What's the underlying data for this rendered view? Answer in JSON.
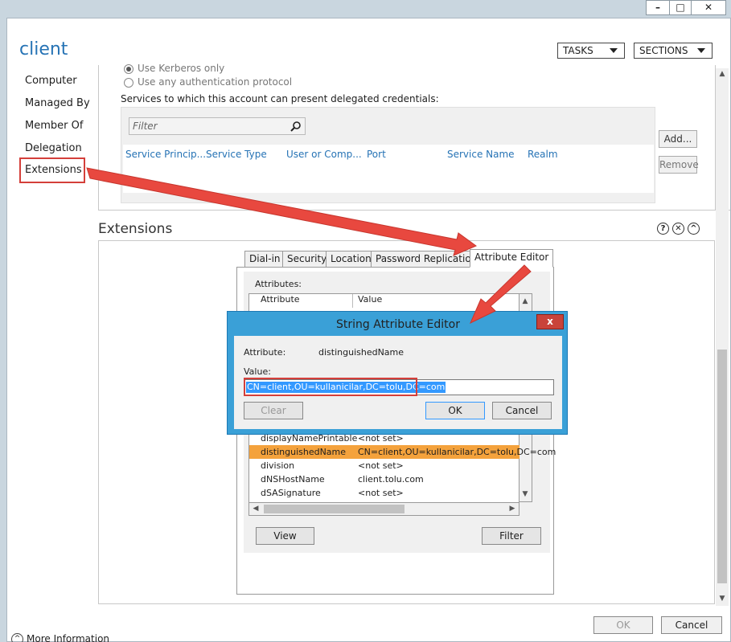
{
  "window": {
    "title": "client",
    "controls": {
      "minimize": "–",
      "maximize": "□",
      "close": "✕"
    },
    "tasks_label": "TASKS",
    "sections_label": "SECTIONS"
  },
  "nav": {
    "items": [
      "Computer",
      "Managed By",
      "Member Of",
      "Delegation",
      "Extensions"
    ]
  },
  "delegation": {
    "radio_kerberos": "Use Kerberos only",
    "radio_any": "Use any authentication protocol",
    "services_label": "Services to which this account can present delegated credentials:",
    "filter_placeholder": "Filter",
    "columns": [
      "Service Princip...",
      "Service Type",
      "User or Comp...",
      "Port",
      "Service Name",
      "Realm"
    ],
    "add_label": "Add...",
    "remove_label": "Remove"
  },
  "extensions": {
    "title": "Extensions",
    "help": "?",
    "close": "✕",
    "collapse": "^",
    "tabs": [
      "Dial-in",
      "Security",
      "Location",
      "Password Replication",
      "Attribute Editor"
    ],
    "attributes_label": "Attributes:",
    "col_attribute": "Attribute",
    "col_value": "Value",
    "rows": [
      {
        "attr": "displayNamePrintable",
        "value": "<not set>"
      },
      {
        "attr": "distinguishedName",
        "value": "CN=client,OU=kullanicilar,DC=tolu,DC=com"
      },
      {
        "attr": "division",
        "value": "<not set>"
      },
      {
        "attr": "dNSHostName",
        "value": "client.tolu.com"
      },
      {
        "attr": "dSASignature",
        "value": "<not set>"
      }
    ],
    "view_label": "View",
    "filter_label": "Filter"
  },
  "string_editor": {
    "title": "String Attribute Editor",
    "close": "x",
    "attribute_label": "Attribute:",
    "attribute_value": "distinguishedName",
    "value_label": "Value:",
    "value": "CN=client,OU=kullanicilar,DC=tolu,DC=com",
    "clear_label": "Clear",
    "ok_label": "OK",
    "cancel_label": "Cancel"
  },
  "footer": {
    "more_info": "More Information",
    "ok_label": "OK",
    "cancel_label": "Cancel"
  },
  "colors": {
    "accent": "#2673b5",
    "highlight_red": "#d43f3a",
    "selected_row": "#f4a23c",
    "dialog_border": "#3aa0d7"
  }
}
